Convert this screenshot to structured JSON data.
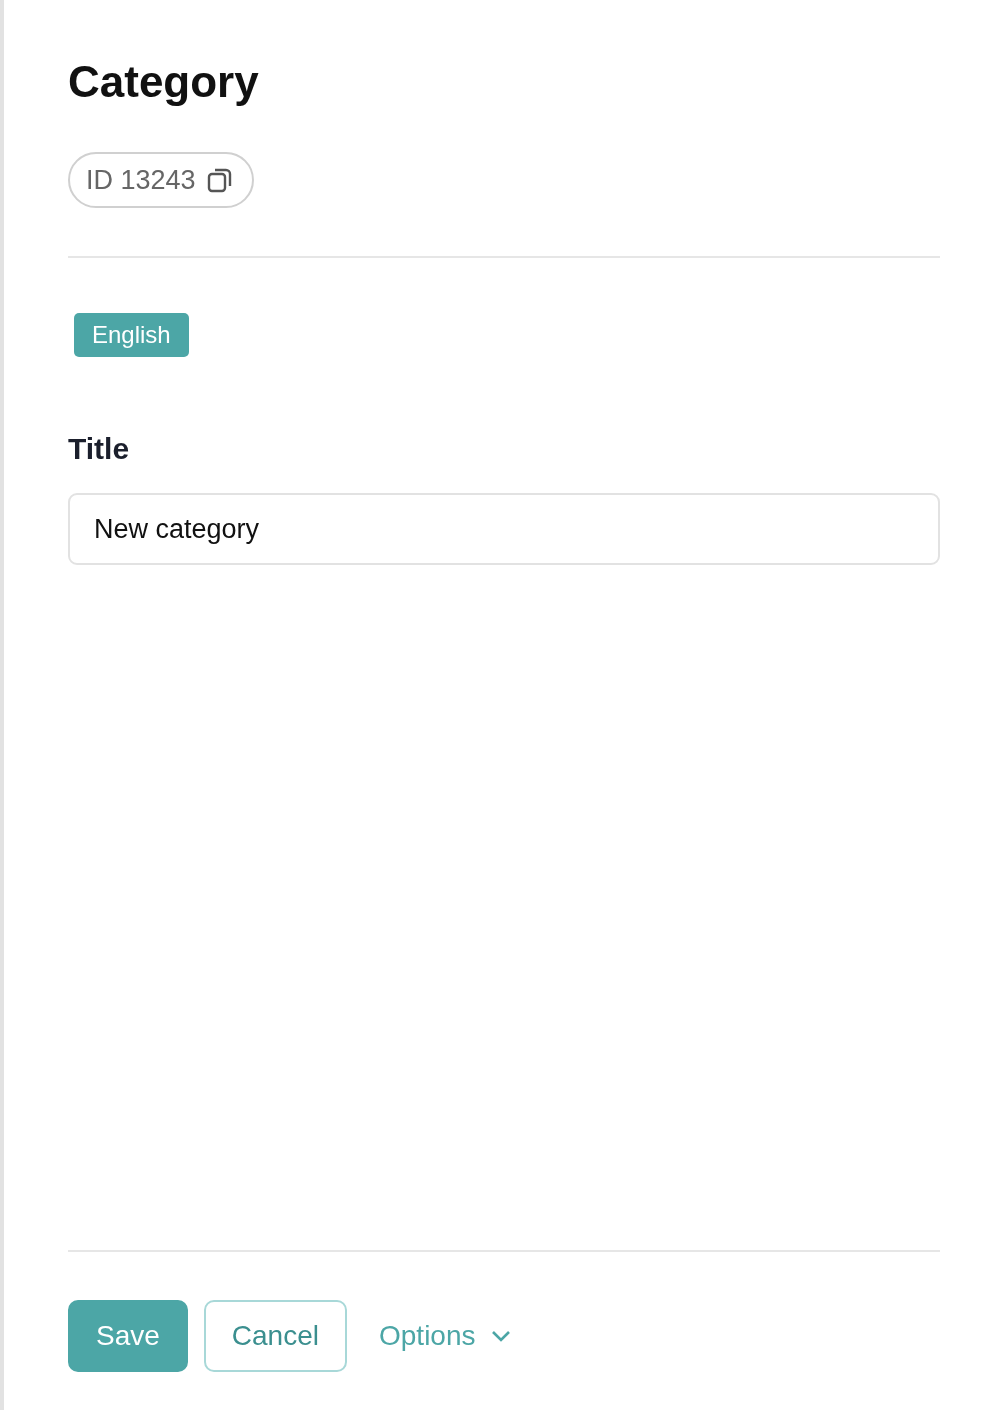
{
  "heading": "Category",
  "id_chip": {
    "label": "ID 13243"
  },
  "language_tag": "English",
  "field": {
    "label": "Title",
    "value": "New category"
  },
  "buttons": [
    {
      "kind": "primary",
      "label": "Save"
    },
    {
      "kind": "outline",
      "label": "Cancel"
    },
    {
      "kind": "dropdown",
      "label": "Options"
    }
  ]
}
